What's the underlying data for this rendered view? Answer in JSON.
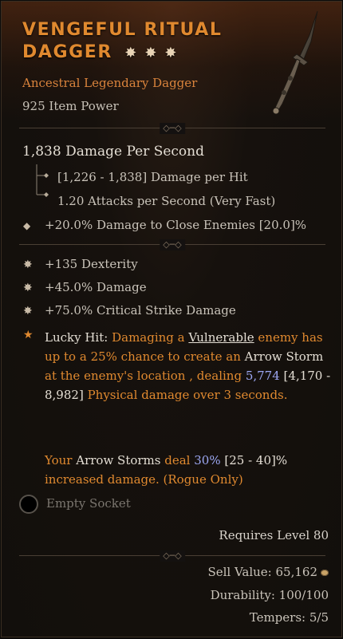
{
  "item": {
    "name_line1": "Vengeful Ritual",
    "name_line2": "Dagger",
    "stars": "✸✸✸",
    "type_line": "Ancestral Legendary Dagger",
    "item_power": "925 Item Power"
  },
  "stats": {
    "dps": "1,838 Damage Per Second",
    "damage_per_hit": "[1,226 - 1,838] Damage per Hit",
    "attacks_per_second": "1.20 Attacks per Second (Very Fast)",
    "implicit": "+20.0% Damage to Close Enemies [20.0]%"
  },
  "affixes": [
    {
      "text": "+135 Dexterity"
    },
    {
      "text": "+45.0% Damage"
    },
    {
      "text": "+75.0% Critical Strike Damage"
    }
  ],
  "aspect": {
    "p1": "Lucky Hit: ",
    "p2": "Damaging a ",
    "p3": "Vulnerable",
    "p4": " enemy has up to a 25% chance to create an ",
    "p5": "Arrow Storm",
    "p6": " at the enemy's location , dealing ",
    "p7": "5,774",
    "p8": " [4,170 - 8,982] ",
    "p9": "Physical damage over 3 seconds."
  },
  "rogue": {
    "p1": "Your ",
    "p2": "Arrow Storms",
    "p3": " deal ",
    "p4": "30%",
    "p5": " [25 - 40]%",
    "p6": " increased damage. (Rogue Only)"
  },
  "socket": {
    "label": "Empty Socket"
  },
  "footer": {
    "requires": "Requires Level 80",
    "sell_value": "Sell Value: 65,162",
    "durability": "Durability: 100/100",
    "tempers": "Tempers: 5/5"
  },
  "colors": {
    "legendary_orange": "#e0892f",
    "value_blue": "#9da8f4",
    "text_grey": "#c9c3b9"
  },
  "icons": [
    "ornament-star-icon",
    "dagger-image",
    "diamond-bullet-icon",
    "star-bullet-icon",
    "socket-icon",
    "gold-coin-icon"
  ]
}
